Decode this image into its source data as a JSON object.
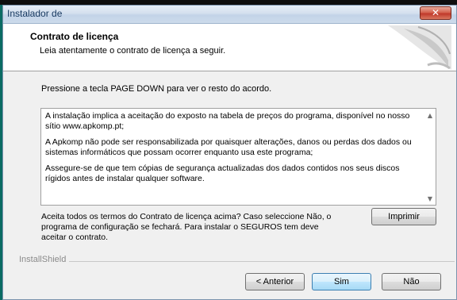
{
  "window": {
    "title": "Instalador de",
    "close_label": "✕"
  },
  "header": {
    "title": "Contrato de licença",
    "subtitle": "Leia atentamente o contrato de licença a seguir."
  },
  "instruction": "Pressione a tecla PAGE DOWN para ver o resto do acordo.",
  "license": {
    "paragraphs": [
      "A instalação implica a aceitação do exposto na tabela de preços do programa, disponível no nosso sítio www.apkomp.pt;",
      "A Apkomp não pode ser responsabilizada por quaisquer alterações, danos ou perdas dos dados ou sistemas informáticos que possam ocorrer enquanto usa este programa;",
      "Assegure-se de que tem cópias de segurança actualizadas dos dados contidos nos seus discos rígidos antes de instalar qualquer software."
    ],
    "scroll_up": "▲",
    "scroll_down": "▼"
  },
  "accept_question": "Aceita todos os termos do Contrato de licença acima? Caso seleccione Não, o programa de configuração se fechará. Para instalar o SEGUROS tem deve aceitar o contrato.",
  "buttons": {
    "print": "Imprimir",
    "back": "< Anterior",
    "yes": "Sim",
    "no": "Não"
  },
  "footer_brand": "InstallShield",
  "colors": {
    "titlebar": "#d3dfee",
    "close_button": "#c0392b",
    "window_bg": "#f0f0f0",
    "accent_left_edge": "#0b6b63"
  }
}
